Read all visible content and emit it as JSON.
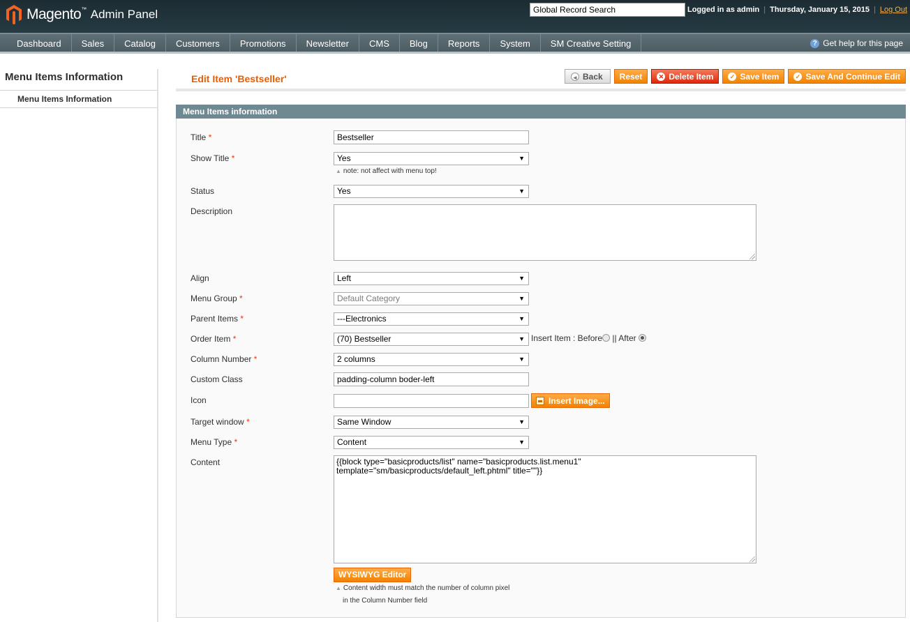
{
  "header": {
    "logo_text": "Magento",
    "logo_tm": "™",
    "logo_sub": "Admin Panel",
    "search_value": "Global Record Search",
    "logged_in": "Logged in as admin",
    "date": "Thursday, January 15, 2015",
    "logout": "Log Out"
  },
  "nav": {
    "items": [
      "Dashboard",
      "Sales",
      "Catalog",
      "Customers",
      "Promotions",
      "Newsletter",
      "CMS",
      "Blog",
      "Reports",
      "System",
      "SM Creative Setting"
    ],
    "help": "Get help for this page"
  },
  "sidebar": {
    "title": "Menu Items Information",
    "items": [
      "Menu Items Information"
    ]
  },
  "page": {
    "title": "Edit Item 'Bestseller'",
    "buttons": {
      "back": "Back",
      "reset": "Reset",
      "delete": "Delete Item",
      "save": "Save Item",
      "save_continue": "Save And Continue Edit"
    }
  },
  "form": {
    "section_title": "Menu Items information",
    "required_mark": "*",
    "title": {
      "label": "Title",
      "value": "Bestseller"
    },
    "show_title": {
      "label": "Show Title",
      "value": "Yes",
      "note": "note: not affect with menu top!"
    },
    "status": {
      "label": "Status",
      "value": "Yes"
    },
    "description": {
      "label": "Description",
      "value": ""
    },
    "align": {
      "label": "Align",
      "value": "Left"
    },
    "menu_group": {
      "label": "Menu Group",
      "value": "Default Category"
    },
    "parent_items": {
      "label": "Parent Items",
      "value": "---Electronics"
    },
    "order_item": {
      "label": "Order Item",
      "value": "(70) Bestseller",
      "insert_label": "Insert Item : Before",
      "separator": "||",
      "after_label": "After"
    },
    "column_number": {
      "label": "Column Number",
      "value": "2 columns"
    },
    "custom_class": {
      "label": "Custom Class",
      "value": "padding-column boder-left"
    },
    "icon": {
      "label": "Icon",
      "value": "",
      "button": "Insert Image..."
    },
    "target_window": {
      "label": "Target window",
      "value": "Same Window"
    },
    "menu_type": {
      "label": "Menu Type",
      "value": "Content"
    },
    "content": {
      "label": "Content",
      "value": "{{block type=\"basicproducts/list\" name=\"basicproducts.list.menu1\" template=\"sm/basicproducts/default_left.phtml\" title=\"\"}}",
      "wysiwyg": "WYSIWYG Editor",
      "note_line1": "Content width must match the number of column pixel",
      "note_line2": "in the Column Number field"
    }
  },
  "colors": {
    "header_bg": "#1d2c33",
    "nav_bg": "#5a6b72",
    "accent_orange": "#f18200",
    "title_orange": "#eb5e00",
    "section_head": "#6f8992",
    "delete_red": "#df280a"
  }
}
